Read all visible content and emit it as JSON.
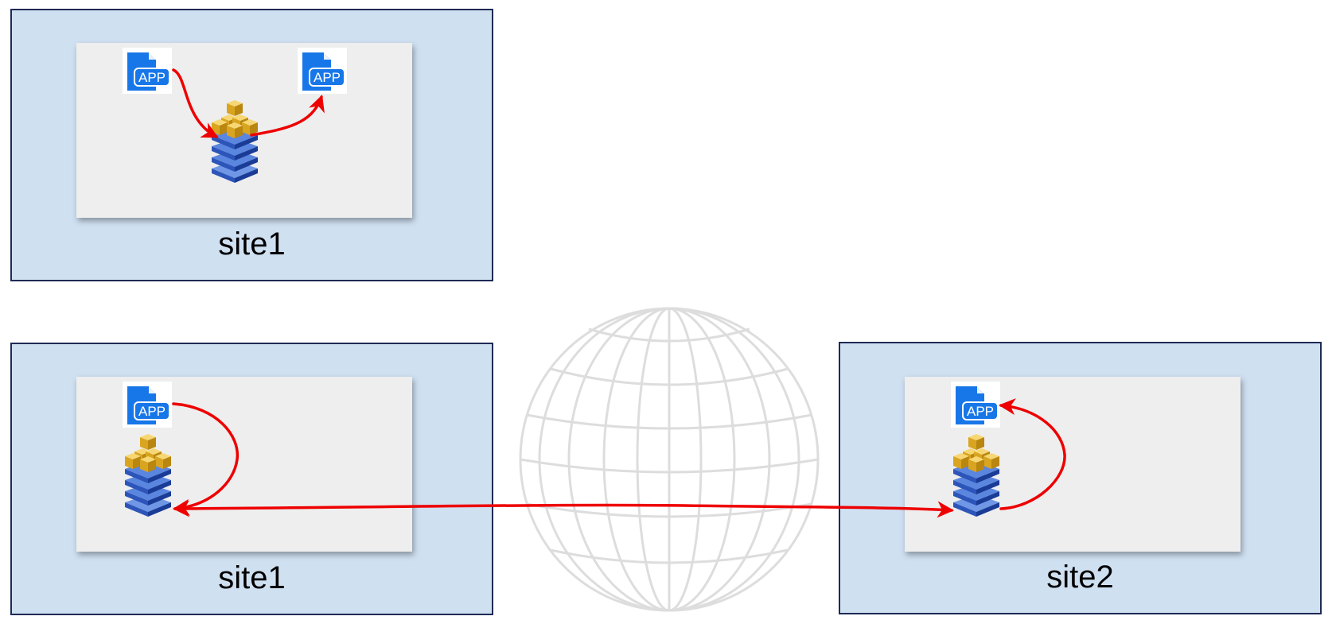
{
  "diagram": {
    "top": {
      "label": "site1"
    },
    "bottom_left": {
      "label": "site1"
    },
    "bottom_right": {
      "label": "site2"
    },
    "icons": {
      "app": "app-document-icon",
      "router": "router-stack-icon",
      "globe": "globe-icon",
      "app_text": "APP"
    },
    "colors": {
      "site_fill": "#cfe0f1",
      "site_border": "#1f2a55",
      "panel_fill": "#eeeeee",
      "arrow": "#ee0000",
      "globe": "#dddddd",
      "app_blue": "#1877e8"
    }
  }
}
